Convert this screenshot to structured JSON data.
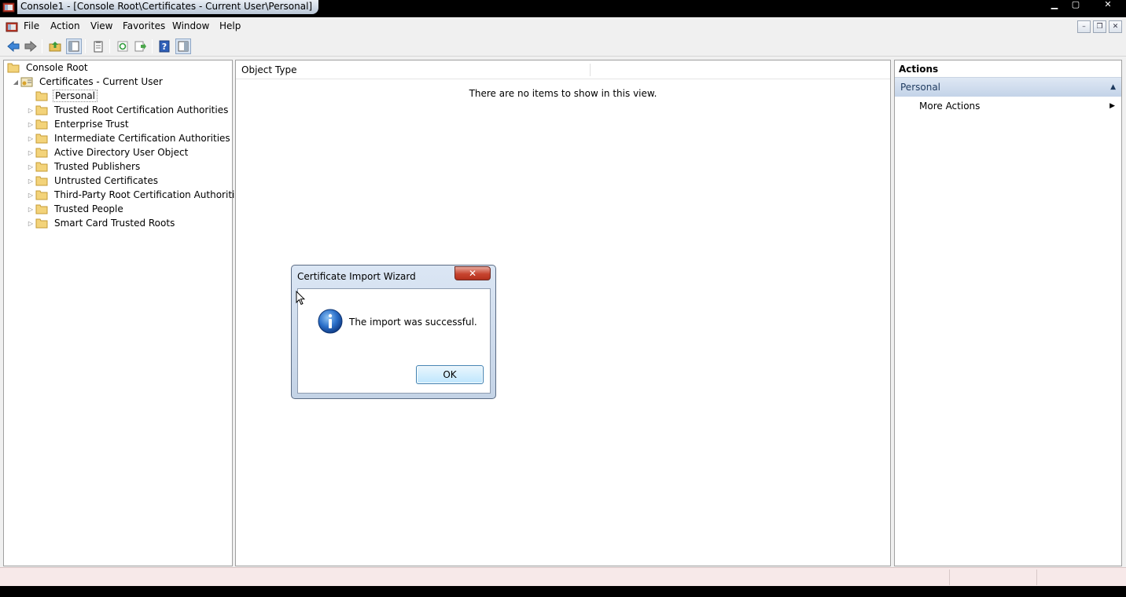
{
  "window": {
    "title": "Console1 - [Console Root\\Certificates - Current User\\Personal]",
    "controls": {
      "minimize": "▁",
      "maximize": "▢",
      "close": "✕"
    }
  },
  "menu": {
    "items": [
      "File",
      "Action",
      "View",
      "Favorites",
      "Window",
      "Help"
    ],
    "mdi_controls": {
      "minimize": "–",
      "restore": "❐",
      "close": "✕"
    }
  },
  "toolbar": {
    "buttons": [
      "back-icon",
      "forward-icon",
      "up-folder-icon",
      "show-hide-tree-icon",
      "clipboard-icon",
      "refresh-icon",
      "export-list-icon",
      "help-icon",
      "show-hide-action-pane-icon"
    ]
  },
  "tree": {
    "root": "Console Root",
    "certificates": "Certificates - Current User",
    "selected": "Personal",
    "items": [
      "Trusted Root Certification Authorities",
      "Enterprise Trust",
      "Intermediate Certification Authorities",
      "Active Directory User Object",
      "Trusted Publishers",
      "Untrusted Certificates",
      "Third-Party Root Certification Authorities",
      "Trusted People",
      "Smart Card Trusted Roots"
    ]
  },
  "list": {
    "column_header": "Object Type",
    "empty_message": "There are no items to show in this view."
  },
  "actions": {
    "title": "Actions",
    "section": "Personal",
    "items": [
      "More Actions"
    ]
  },
  "dialog": {
    "title": "Certificate Import Wizard",
    "close_label": "✕",
    "message": "The import was successful.",
    "ok_label": "OK"
  },
  "colors": {
    "actions_header": "#c3d3e8",
    "dialog_frame": "#c4d3e6",
    "statusbar": "#f7e9e9",
    "close_button": "#c7442f"
  }
}
